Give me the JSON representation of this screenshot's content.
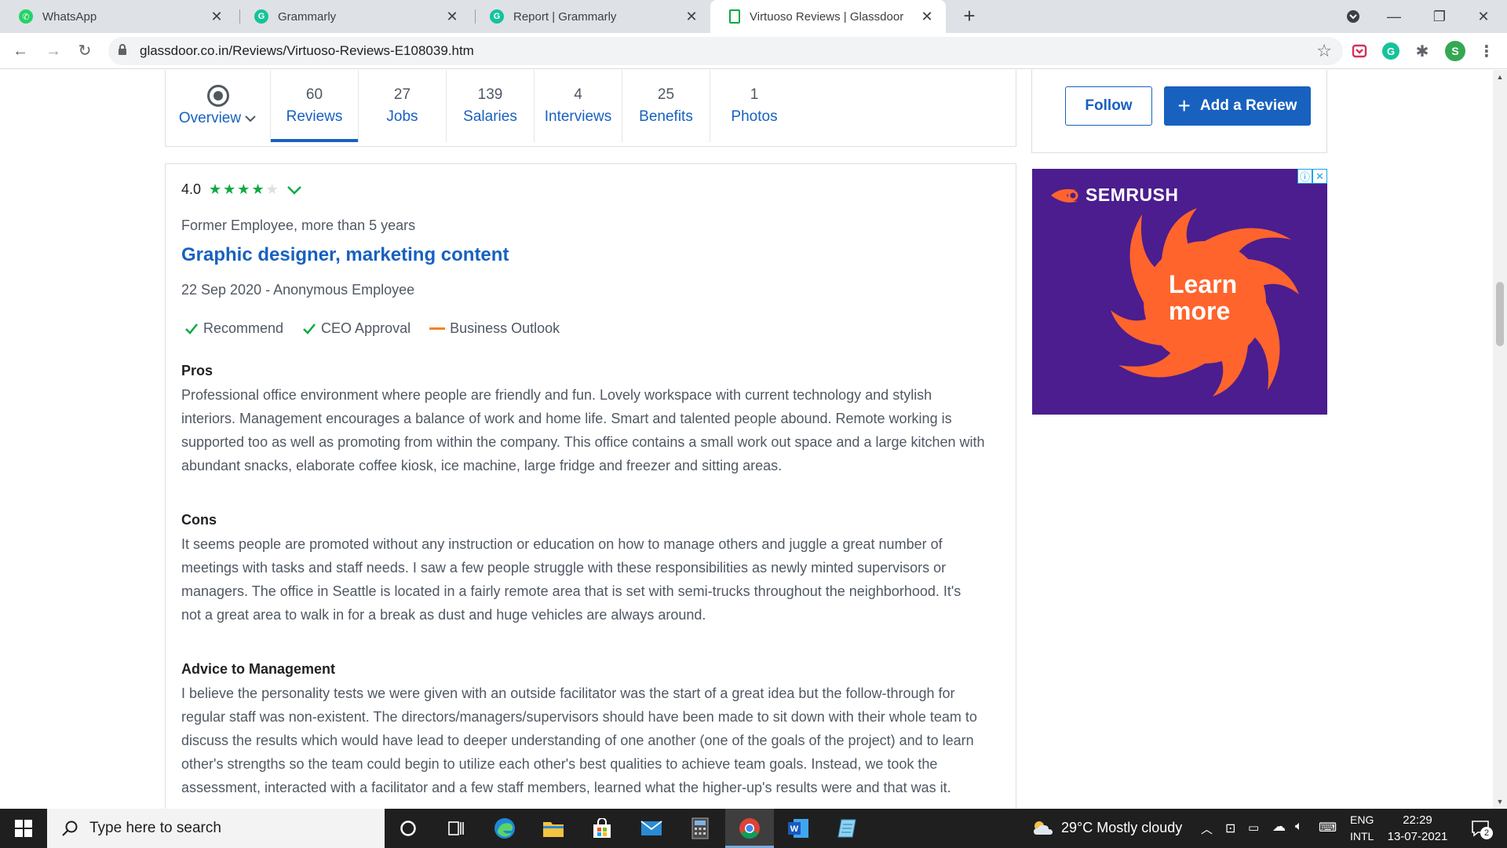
{
  "browser": {
    "tabs": [
      {
        "title": "WhatsApp",
        "icon": "whatsapp-icon",
        "color": "#25d366"
      },
      {
        "title": "Grammarly",
        "icon": "grammarly-icon",
        "color": "#15c39a"
      },
      {
        "title": "Report | Grammarly",
        "icon": "grammarly-icon",
        "color": "#15c39a"
      },
      {
        "title": "Virtuoso Reviews | Glassdoor",
        "icon": "glassdoor-icon",
        "color": "#0caa41"
      }
    ],
    "url": "glassdoor.co.in/Reviews/Virtuoso-Reviews-E108039.htm",
    "profile_initial": "S"
  },
  "subnav": {
    "overview_label": "Overview",
    "items": [
      {
        "count": "60",
        "label": "Reviews"
      },
      {
        "count": "27",
        "label": "Jobs"
      },
      {
        "count": "139",
        "label": "Salaries"
      },
      {
        "count": "4",
        "label": "Interviews"
      },
      {
        "count": "25",
        "label": "Benefits"
      },
      {
        "count": "1",
        "label": "Photos"
      }
    ],
    "follow_label": "Follow",
    "add_review_label": "Add a Review"
  },
  "review": {
    "rating": "4.0",
    "stars_filled": 4,
    "stars_total": 5,
    "job_status": "Former Employee, more than 5 years",
    "title": "Graphic designer, marketing content",
    "date_author": "22 Sep 2020 - Anonymous Employee",
    "sub_ratings": [
      {
        "label": "Recommend",
        "state": "positive"
      },
      {
        "label": "CEO Approval",
        "state": "positive"
      },
      {
        "label": "Business Outlook",
        "state": "neutral"
      }
    ],
    "pros_title": "Pros",
    "pros_lines": [
      "Professional office environment where people are friendly and fun. Lovely workspace with current technology and stylish",
      "interiors. Management encourages a balance of work and home life. Smart and talented people abound. Remote working is",
      "supported too as well as promoting from within the company. This office contains a small work out space and a large kitchen with",
      "abundant snacks, elaborate coffee kiosk, ice machine, large fridge and freezer and sitting areas."
    ],
    "cons_title": "Cons",
    "cons_lines": [
      "It seems people are promoted without any instruction or education on how to manage others and juggle a great number of",
      "meetings with tasks and staff needs. I saw a few people struggle with these responsibilities as newly minted supervisors or",
      "managers. The office in Seattle is located in a fairly remote area that is set with semi-trucks throughout the neighborhood. It's",
      "not a great area to walk in for a break as dust and huge vehicles are always around."
    ],
    "advice_title": "Advice to Management",
    "advice_lines": [
      "I believe the personality tests we were given with an outside facilitator was the start of a great idea but the follow-through for",
      "regular staff was non-existent. The directors/managers/supervisors should have been made to sit down with their whole team to",
      "discuss the results which would have lead to deeper understanding of one another (one of the goals of the project) and to learn",
      "other's strengths so the team could begin to utilize each other's best qualities to achieve team goals. Instead, we took the",
      "assessment, interacted with a facilitator and a few staff members, learned what the higher-up's results were and that was it."
    ]
  },
  "ad": {
    "brand": "SEMRUSH",
    "cta_line1": "Learn",
    "cta_line2": "more",
    "bg_color": "#4b1d8e",
    "accent_color": "#ff642d"
  },
  "taskbar": {
    "search_placeholder": "Type here to search",
    "weather": "29°C  Mostly cloudy",
    "lang_line1": "ENG",
    "lang_line2": "INTL",
    "time": "22:29",
    "date": "13-07-2021",
    "notification_count": "2"
  },
  "colors": {
    "link_blue": "#1861bf",
    "star_green": "#0caa41",
    "neutral_orange": "#f5831f"
  }
}
